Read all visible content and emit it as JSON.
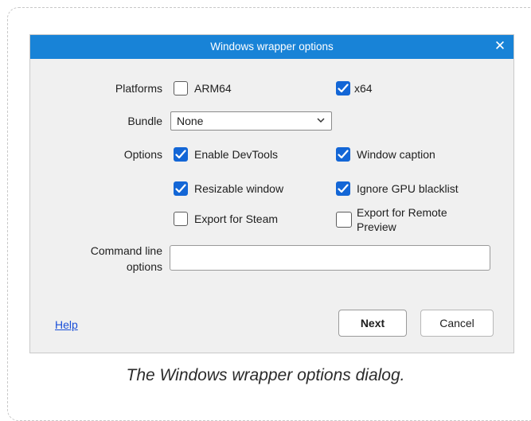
{
  "dialog": {
    "title": "Windows wrapper options",
    "close_glyph": "✕",
    "platforms_label": "Platforms",
    "platforms": [
      {
        "label": "ARM64",
        "checked": false
      },
      {
        "label": "x64",
        "checked": true
      }
    ],
    "bundle_label": "Bundle",
    "bundle_value": "None",
    "options_label": "Options",
    "options": [
      {
        "label": "Enable DevTools",
        "checked": true
      },
      {
        "label": "Window caption",
        "checked": true
      },
      {
        "label": "Resizable window",
        "checked": true
      },
      {
        "label": "Ignore GPU blacklist",
        "checked": true
      },
      {
        "label": "Export for Steam",
        "checked": false
      },
      {
        "label": "Export for Remote Preview",
        "checked": false
      }
    ],
    "command_line_label": "Command line options",
    "command_line_value": "",
    "help_label": "Help",
    "next_label": "Next",
    "cancel_label": "Cancel"
  },
  "caption": "The Windows wrapper options dialog.",
  "colors": {
    "titlebar": "#1883d7",
    "checkbox_checked": "#1366d6",
    "link": "#1a4fd8"
  },
  "icons": {
    "close": "close-icon",
    "checkmark": "checkmark-icon",
    "dropdown": "chevron-down-icon"
  }
}
